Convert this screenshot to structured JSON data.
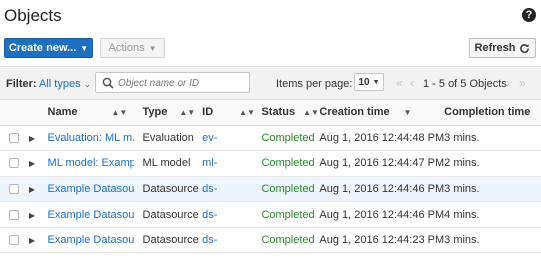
{
  "header": {
    "title": "Objects",
    "help_glyph": "?"
  },
  "toolbar": {
    "create_label": "Create new...",
    "actions_label": "Actions",
    "refresh_label": "Refresh"
  },
  "filter": {
    "label": "Filter:",
    "value": "All types",
    "search_placeholder": "Object name or ID"
  },
  "pagination": {
    "items_label": "Items per page:",
    "items_value": "10",
    "range_text": "1 - 5 of 5 Objects"
  },
  "table": {
    "columns": [
      "Name",
      "Type",
      "ID",
      "Status",
      "Creation time",
      "Completion time"
    ],
    "rows": [
      {
        "name": "Evaluation: ML m...",
        "type": "Evaluation",
        "id": "ev-",
        "status": "Completed",
        "created": "Aug 1, 2016 12:44:48 PM",
        "completion": "3 mins."
      },
      {
        "name": "ML model: Exampl...",
        "type": "ML model",
        "id": "ml-",
        "status": "Completed",
        "created": "Aug 1, 2016 12:44:47 PM",
        "completion": "2 mins."
      },
      {
        "name": "Example Datasour...",
        "type": "Datasource",
        "id": "ds-",
        "status": "Completed",
        "created": "Aug 1, 2016 12:44:46 PM",
        "completion": "3 mins."
      },
      {
        "name": "Example Datasour...",
        "type": "Datasource",
        "id": "ds-",
        "status": "Completed",
        "created": "Aug 1, 2016 12:44:46 PM",
        "completion": "4 mins."
      },
      {
        "name": "Example Datasour...",
        "type": "Datasource",
        "id": "ds-",
        "status": "Completed",
        "created": "Aug 1, 2016 12:44:23 PM",
        "completion": "3 mins."
      }
    ]
  },
  "colors": {
    "accent": "#1f6fbf",
    "status_completed": "#2a8a2a",
    "selected_row": "#eef5fc"
  }
}
